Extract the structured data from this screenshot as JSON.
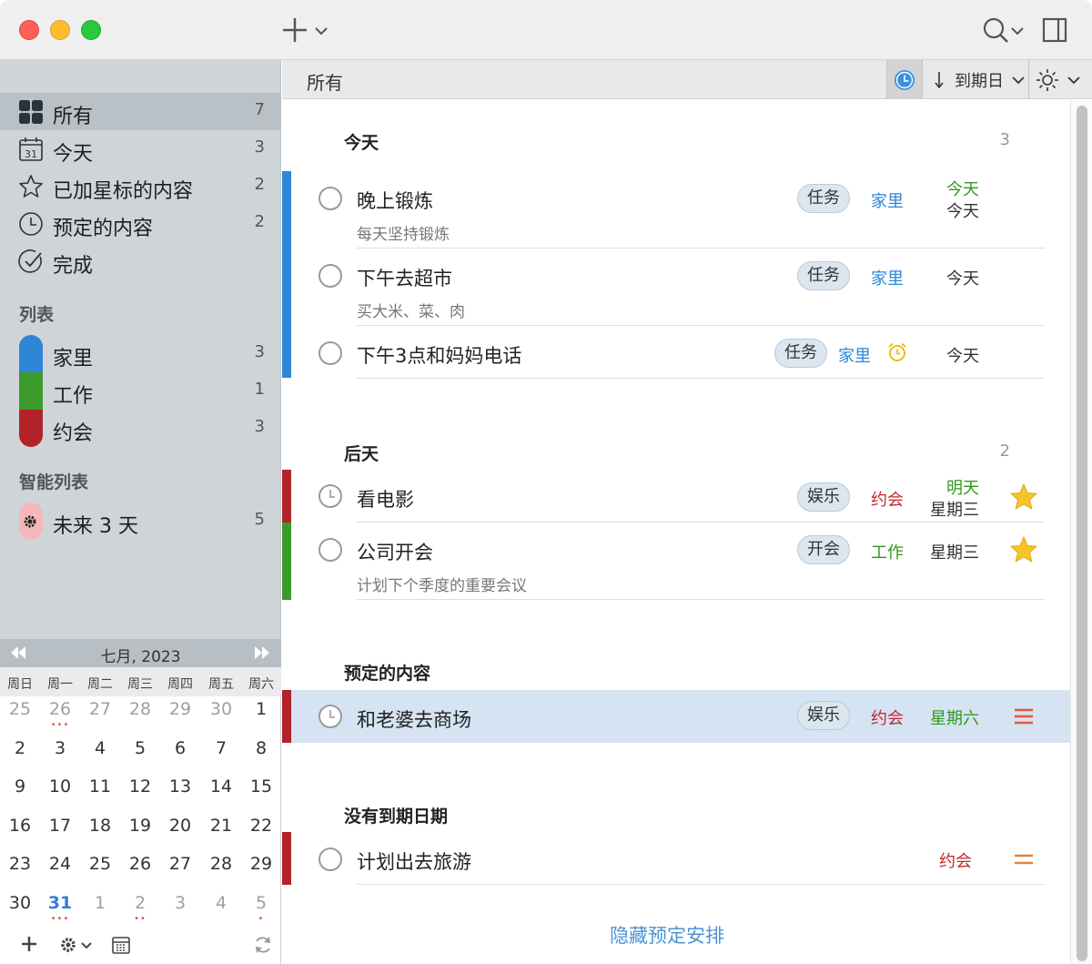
{
  "window": {
    "add_label": "+",
    "search_label": "search"
  },
  "sidebar": {
    "smart_items": [
      {
        "label": "所有",
        "count": "7",
        "icon": "grid-icon"
      },
      {
        "label": "今天",
        "count": "3",
        "icon": "calendar-31-icon",
        "icon_text": "31"
      },
      {
        "label": "已加星标的内容",
        "count": "2",
        "icon": "star-outline-icon"
      },
      {
        "label": "预定的内容",
        "count": "2",
        "icon": "clock-icon"
      },
      {
        "label": "完成",
        "count": "",
        "icon": "check-circle-icon"
      }
    ],
    "lists_heading": "列表",
    "lists": [
      {
        "label": "家里",
        "count": "3",
        "color": "#2e86d6"
      },
      {
        "label": "工作",
        "count": "1",
        "color": "#3a9a2a"
      },
      {
        "label": "约会",
        "count": "3",
        "color": "#b22229"
      }
    ],
    "smart_lists_heading": "智能列表",
    "smart_lists": [
      {
        "label": "未来 3 天",
        "count": "5",
        "color": "#f5b8b8",
        "icon": "gear-icon"
      }
    ]
  },
  "calendar": {
    "title": "七月, 2023",
    "weekdays": [
      "周日",
      "周一",
      "周二",
      "周三",
      "周四",
      "周五",
      "周六"
    ],
    "weeks": [
      [
        "25",
        "26",
        "27",
        "28",
        "29",
        "30",
        "1"
      ],
      [
        "2",
        "3",
        "4",
        "5",
        "6",
        "7",
        "8"
      ],
      [
        "9",
        "10",
        "11",
        "12",
        "13",
        "14",
        "15"
      ],
      [
        "16",
        "17",
        "18",
        "19",
        "20",
        "21",
        "22"
      ],
      [
        "23",
        "24",
        "25",
        "26",
        "27",
        "28",
        "29"
      ],
      [
        "30",
        "31",
        "1",
        "2",
        "3",
        "4",
        "5"
      ]
    ]
  },
  "main": {
    "header_title": "所有",
    "sort_label": "到期日",
    "groups": [
      {
        "title": "今天",
        "count": "3"
      },
      {
        "title": "后天",
        "count": "2"
      },
      {
        "title": "预定的内容",
        "count": ""
      },
      {
        "title": "没有到期日期",
        "count": ""
      }
    ],
    "tasks": [
      {
        "title": "晚上锻炼",
        "note": "每天坚持锻炼",
        "tag": "任务",
        "list": "家里",
        "list_color": "#2e86d6",
        "date1": "今天",
        "date1_color": "#2f9a1d",
        "date2": "今天",
        "date2_color": "#333333"
      },
      {
        "title": "下午去超市",
        "note": "买大米、菜、肉",
        "tag": "任务",
        "list": "家里",
        "list_color": "#2e86d6",
        "date1": "今天",
        "date1_color": "#333333"
      },
      {
        "title": "下午3点和妈妈电话",
        "note": "",
        "tag": "任务",
        "list": "家里",
        "list_color": "#2e86d6",
        "date1": "今天",
        "date1_color": "#333333"
      },
      {
        "title": "看电影",
        "note": "",
        "tag": "娱乐",
        "list": "约会",
        "list_color": "#c0282e",
        "date1": "明天",
        "date1_color": "#2f9a1d",
        "date2": "星期三",
        "date2_color": "#333333"
      },
      {
        "title": "公司开会",
        "note": "计划下个季度的重要会议",
        "tag": "开会",
        "list": "工作",
        "list_color": "#2f9a1d",
        "date1": "星期三",
        "date1_color": "#333333"
      },
      {
        "title": "和老婆去商场",
        "note": "",
        "tag": "娱乐",
        "list": "约会",
        "list_color": "#c0282e",
        "date1": "星期六",
        "date1_color": "#2f9a1d"
      },
      {
        "title": "计划出去旅游",
        "note": "",
        "tag": "",
        "list": "约会",
        "list_color": "#c0282e"
      }
    ],
    "footer_link": "隐藏预定安排"
  }
}
